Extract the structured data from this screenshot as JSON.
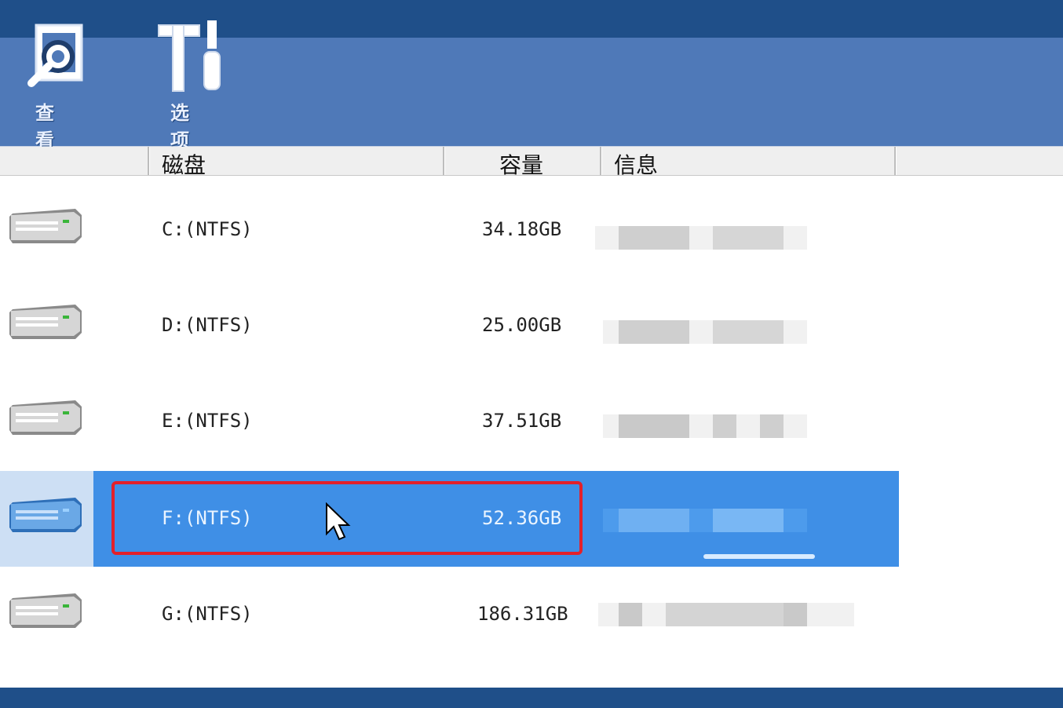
{
  "toolbar": {
    "view_label": "查 看",
    "options_label": "选 项"
  },
  "columns": {
    "disk": "磁盘",
    "capacity": "容量",
    "info": "信息"
  },
  "drives": [
    {
      "disk": "C:(NTFS)",
      "capacity": "34.18GB",
      "selected": false
    },
    {
      "disk": "D:(NTFS)",
      "capacity": "25.00GB",
      "selected": false
    },
    {
      "disk": "E:(NTFS)",
      "capacity": "37.51GB",
      "selected": false
    },
    {
      "disk": "F:(NTFS)",
      "capacity": "52.36GB",
      "selected": true
    },
    {
      "disk": "G:(NTFS)",
      "capacity": "186.31GB",
      "selected": false
    }
  ],
  "colors": {
    "toolbar_bg": "#4f79b8",
    "top_dark": "#1f4f89",
    "selection": "#3f8fe6",
    "highlight_border": "#e3202a"
  },
  "icons": {
    "view": "magnifier-icon",
    "options": "tools-icon",
    "drive": "hard-drive-icon",
    "cursor": "mouse-pointer-icon"
  }
}
